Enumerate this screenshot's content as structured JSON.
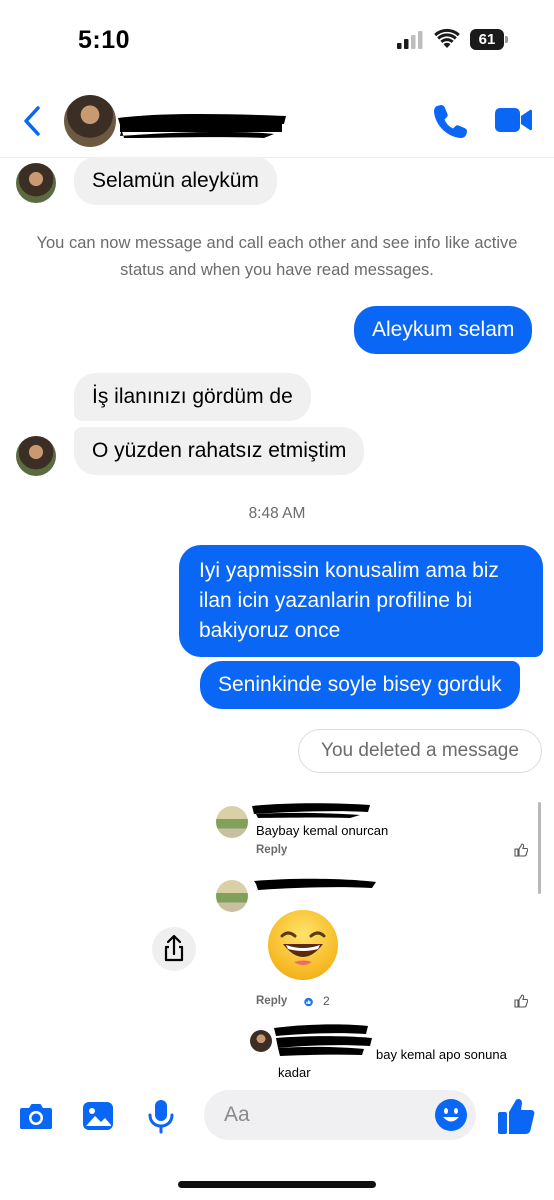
{
  "status_bar": {
    "time": "5:10",
    "battery": "61"
  },
  "header": {
    "contact_name_redacted": ""
  },
  "colors": {
    "accent": "#0a66f5",
    "incoming_bubble": "#f0f0f0",
    "outgoing_text": "#ffffff",
    "meta_text": "#6b6b6b"
  },
  "icons": {
    "back": "chevron-left-icon",
    "call": "phone-icon",
    "video": "video-camera-icon",
    "camera": "camera-icon",
    "gallery": "photo-icon",
    "mic": "microphone-icon",
    "emoji": "emoji-icon",
    "like": "thumbs-up-icon",
    "share": "share-icon"
  },
  "messages": {
    "m1": "Selamün aleyküm",
    "info": "You can now message and call each other and see info like active status and when you have read messages.",
    "m2": "Aleykum selam",
    "m3": "İş ilanınızı gördüm de",
    "m4": "O yüzden rahatsız etmiştim",
    "timestamp": "8:48 AM",
    "m5": "Iyi yapmissin konusalim ama biz ilan icin yazanlarin profiline bi bakiyoruz once",
    "m6": "Seninkinde soyle bisey gorduk",
    "deleted": "You deleted a message"
  },
  "shared_image": {
    "comment1_text": "Baybay kemal onurcan",
    "reply1": "Reply",
    "reply2": "Reply",
    "reaction_count": "2",
    "comment3_text": "bay kemal apo sonuna",
    "comment3_text_cont": "kadar"
  },
  "composer": {
    "placeholder": "Aa"
  }
}
